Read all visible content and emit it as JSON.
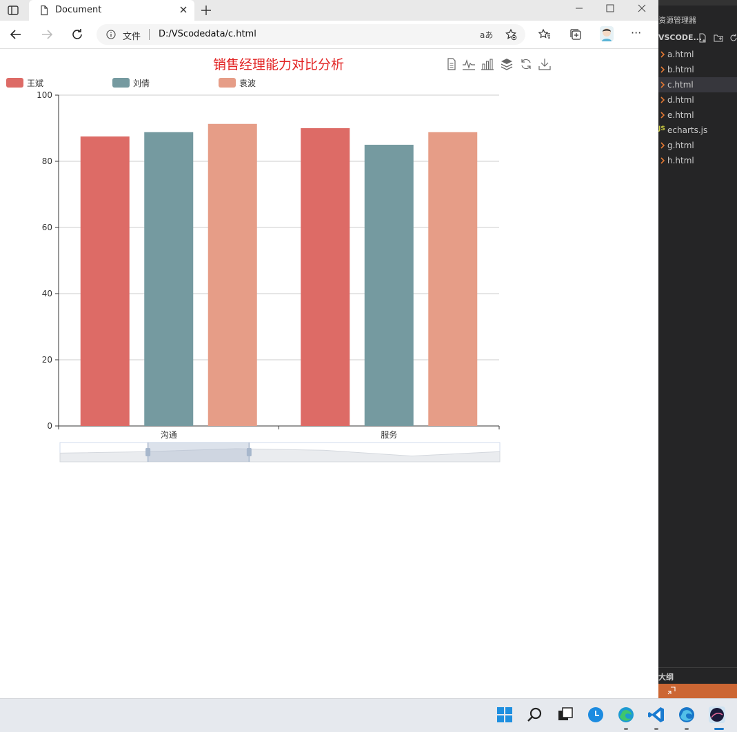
{
  "browser": {
    "tab_title": "Document",
    "address_label": "文件",
    "url": "D:/VScodedata/c.html",
    "read_aloud_label": "aあ",
    "more_label": "···"
  },
  "chart": {
    "title": "销售经理能力对比分析",
    "toolbox": [
      "data-view-icon",
      "line-chart-icon",
      "bar-chart-icon",
      "stack-icon",
      "restore-icon",
      "save-image-icon"
    ],
    "colors": [
      "#dd6b66",
      "#759aa0",
      "#e69d87"
    ]
  },
  "chart_data": {
    "type": "bar",
    "title": "销售经理能力对比分析",
    "categories": [
      "沟通",
      "服务"
    ],
    "series": [
      {
        "name": "王斌",
        "values": [
          87.5,
          90
        ]
      },
      {
        "name": "刘倩",
        "values": [
          88.8,
          85
        ]
      },
      {
        "name": "袁波",
        "values": [
          91.3,
          88.8
        ]
      }
    ],
    "ylim": [
      0,
      100
    ],
    "yticks": [
      "0",
      "20",
      "40",
      "60",
      "80",
      "100"
    ],
    "grid": true,
    "legend": "top-left",
    "datazoom": {
      "start_percent": 20,
      "end_percent": 43,
      "preview": [
        87.5,
        88.8,
        91.3,
        90,
        85,
        88.8
      ]
    }
  },
  "vscode": {
    "explorer_title": "资源管理器",
    "folder": "VSCODE...",
    "files": [
      "a.html",
      "b.html",
      "c.html",
      "d.html",
      "e.html",
      "echarts.js",
      "g.html",
      "h.html"
    ],
    "active_file": "c.html",
    "js_badge": "JS",
    "outline_label": "大纲"
  },
  "taskbar": {
    "apps": [
      "windows-start-icon",
      "search-icon",
      "task-view-icon",
      "clock-app-icon",
      "edge-icon",
      "vscode-icon",
      "edge-beta-icon",
      "wallpaper-app-icon"
    ]
  }
}
